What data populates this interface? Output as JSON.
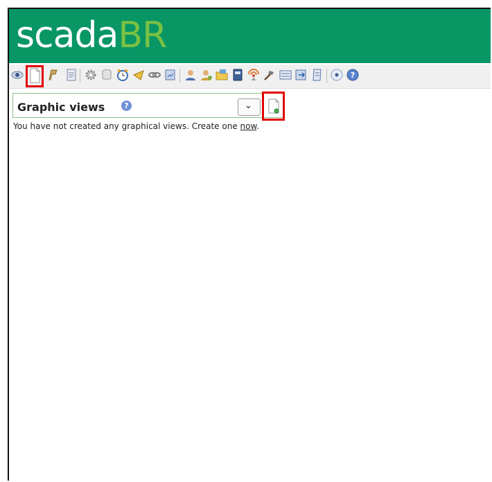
{
  "app": {
    "logo_part1": "scada",
    "logo_part2": "BR",
    "colors": {
      "header": "#079664",
      "logo_white": "#ffffff",
      "logo_green": "#7ac143",
      "highlight": "#e00000"
    }
  },
  "toolbar": {
    "icons": [
      "watchlist-eye-icon",
      "graphic-views-icon",
      "event-flag-icon",
      "reports-icon",
      "data-sources-icon",
      "database-icon",
      "scheduled-events-icon",
      "compound-events-icon",
      "point-links-icon",
      "scripts-icon",
      "users-icon",
      "user-profiles-icon",
      "point-hierarchy-icon",
      "mailing-lists-icon",
      "publishers-icon",
      "maintenance-events-icon",
      "system-settings-icon",
      "emport-icon",
      "sql-icon",
      "logout-icon",
      "help-icon"
    ]
  },
  "graphic_views": {
    "title": "Graphic views",
    "message_prefix": "You have not created any graphical views. Create one",
    "link": "now",
    "message_suffix": "."
  }
}
